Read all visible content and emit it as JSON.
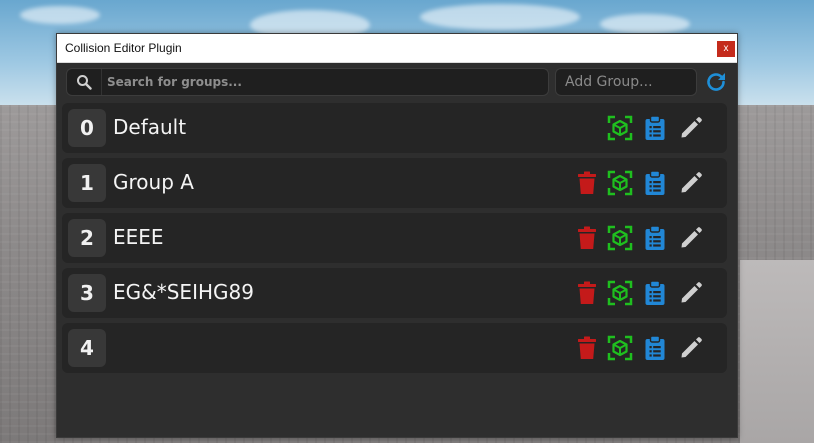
{
  "window": {
    "title": "Collision Editor Plugin",
    "close_label": "x"
  },
  "toolbar": {
    "search_placeholder": "Search for groups...",
    "add_group_placeholder": "Add Group..."
  },
  "colors": {
    "delete": "#c41a1a",
    "select": "#1fbf1f",
    "paste": "#2187d6",
    "edit": "#cfcfcf",
    "refresh": "#1e8fd8"
  },
  "icons": [
    "search-icon",
    "refresh-icon",
    "trash-icon",
    "select-cube-icon",
    "clipboard-icon",
    "pencil-icon"
  ],
  "groups": [
    {
      "index": "0",
      "name": "Default"
    },
    {
      "index": "1",
      "name": "Group A"
    },
    {
      "index": "2",
      "name": "EEEE"
    },
    {
      "index": "3",
      "name": "EG&*SEIHG89"
    },
    {
      "index": "4",
      "name": ""
    }
  ]
}
